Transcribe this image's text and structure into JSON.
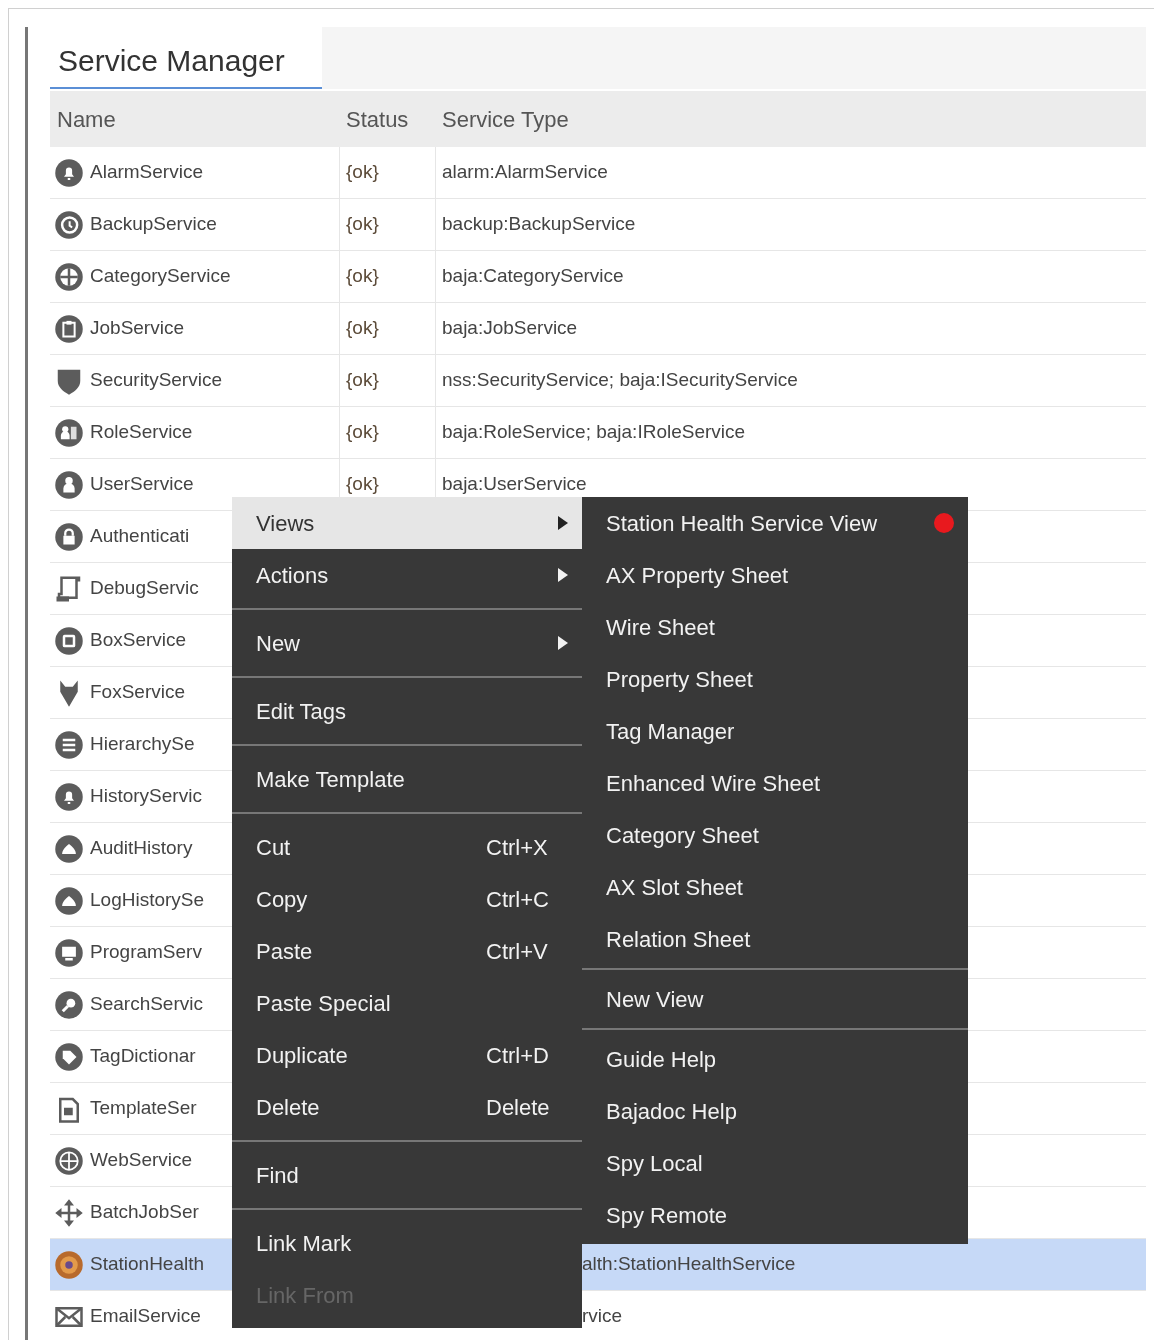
{
  "tab": {
    "label": "Service Manager",
    "selected": true
  },
  "table": {
    "columns": [
      "Name",
      "Status",
      "Service Type"
    ],
    "rows": [
      {
        "name": "AlarmService",
        "status": "{ok}",
        "service_type": "alarm:AlarmService",
        "selected": false
      },
      {
        "name": "BackupService",
        "status": "{ok}",
        "service_type": "backup:BackupService",
        "selected": false
      },
      {
        "name": "CategoryService",
        "status": "{ok}",
        "service_type": "baja:CategoryService",
        "selected": false
      },
      {
        "name": "JobService",
        "status": "{ok}",
        "service_type": "baja:JobService",
        "selected": false
      },
      {
        "name": "SecurityService",
        "status": "{ok}",
        "service_type": "nss:SecurityService; baja:ISecurityService",
        "selected": false
      },
      {
        "name": "RoleService",
        "status": "{ok}",
        "service_type": "baja:RoleService; baja:IRoleService",
        "selected": false
      },
      {
        "name": "UserService",
        "status": "{ok}",
        "service_type": "baja:UserService",
        "selected": false
      },
      {
        "name": "Authenticati",
        "selected": false
      },
      {
        "name": "DebugServic",
        "selected": false
      },
      {
        "name": "BoxService",
        "selected": false
      },
      {
        "name": "FoxService",
        "selected": false
      },
      {
        "name": "HierarchySe",
        "selected": false
      },
      {
        "name": "HistoryServic",
        "selected": false
      },
      {
        "name": "AuditHistory",
        "selected": false
      },
      {
        "name": "LogHistorySe",
        "selected": false
      },
      {
        "name": "ProgramServ",
        "selected": false
      },
      {
        "name": "SearchServic",
        "selected": false
      },
      {
        "name": "TagDictionar",
        "selected": false
      },
      {
        "name": "TemplateSer",
        "selected": false
      },
      {
        "name": "WebService",
        "selected": false
      },
      {
        "name": "BatchJobSer",
        "selected": false
      },
      {
        "name": "StationHealth",
        "service_type_clipped": "alth:StationHealthService",
        "selected": true
      },
      {
        "name": "EmailService",
        "service_type_clipped": "rvice",
        "selected": false
      }
    ]
  },
  "context_menu": {
    "groups": [
      [
        {
          "label": "Views",
          "submenu": true,
          "selected": true,
          "disabled": false
        },
        {
          "label": "Actions",
          "submenu": true,
          "selected": false,
          "disabled": false
        }
      ],
      [
        {
          "label": "New",
          "submenu": true,
          "selected": false,
          "disabled": false
        }
      ],
      [
        {
          "label": "Edit Tags",
          "submenu": false,
          "selected": false,
          "disabled": false
        }
      ],
      [
        {
          "label": "Make Template",
          "submenu": false,
          "selected": false,
          "disabled": false
        }
      ],
      [
        {
          "label": "Cut",
          "shortcut": "Ctrl+X",
          "submenu": false,
          "selected": false,
          "disabled": false
        },
        {
          "label": "Copy",
          "shortcut": "Ctrl+C",
          "submenu": false,
          "selected": false,
          "disabled": false
        },
        {
          "label": "Paste",
          "shortcut": "Ctrl+V",
          "submenu": false,
          "selected": false,
          "disabled": false
        },
        {
          "label": "Paste Special",
          "submenu": false,
          "selected": false,
          "disabled": false
        },
        {
          "label": "Duplicate",
          "shortcut": "Ctrl+D",
          "submenu": false,
          "selected": false,
          "disabled": false
        },
        {
          "label": "Delete",
          "shortcut": "Delete",
          "submenu": false,
          "selected": false,
          "disabled": false
        }
      ],
      [
        {
          "label": "Find",
          "submenu": false,
          "selected": false,
          "disabled": false
        }
      ],
      [
        {
          "label": "Link Mark",
          "submenu": false,
          "selected": false,
          "disabled": false
        },
        {
          "label": "Link From",
          "submenu": false,
          "selected": false,
          "disabled": true
        }
      ]
    ]
  },
  "views_submenu": {
    "groups": [
      [
        {
          "label": "Station Health Service View",
          "flagged": true
        },
        {
          "label": "AX Property Sheet",
          "flagged": false
        },
        {
          "label": "Wire Sheet",
          "flagged": false
        },
        {
          "label": "Property Sheet",
          "flagged": false
        },
        {
          "label": "Tag Manager",
          "flagged": false
        },
        {
          "label": "Enhanced Wire Sheet",
          "flagged": false
        },
        {
          "label": "Category Sheet",
          "flagged": false
        },
        {
          "label": "AX Slot Sheet",
          "flagged": false
        },
        {
          "label": "Relation Sheet",
          "flagged": false
        }
      ],
      [
        {
          "label": "New View",
          "flagged": false
        }
      ],
      [
        {
          "label": "Guide Help",
          "flagged": false
        },
        {
          "label": "Bajadoc Help",
          "flagged": false
        },
        {
          "label": "Spy Local",
          "flagged": false
        },
        {
          "label": "Spy Remote",
          "flagged": false
        }
      ]
    ]
  }
}
